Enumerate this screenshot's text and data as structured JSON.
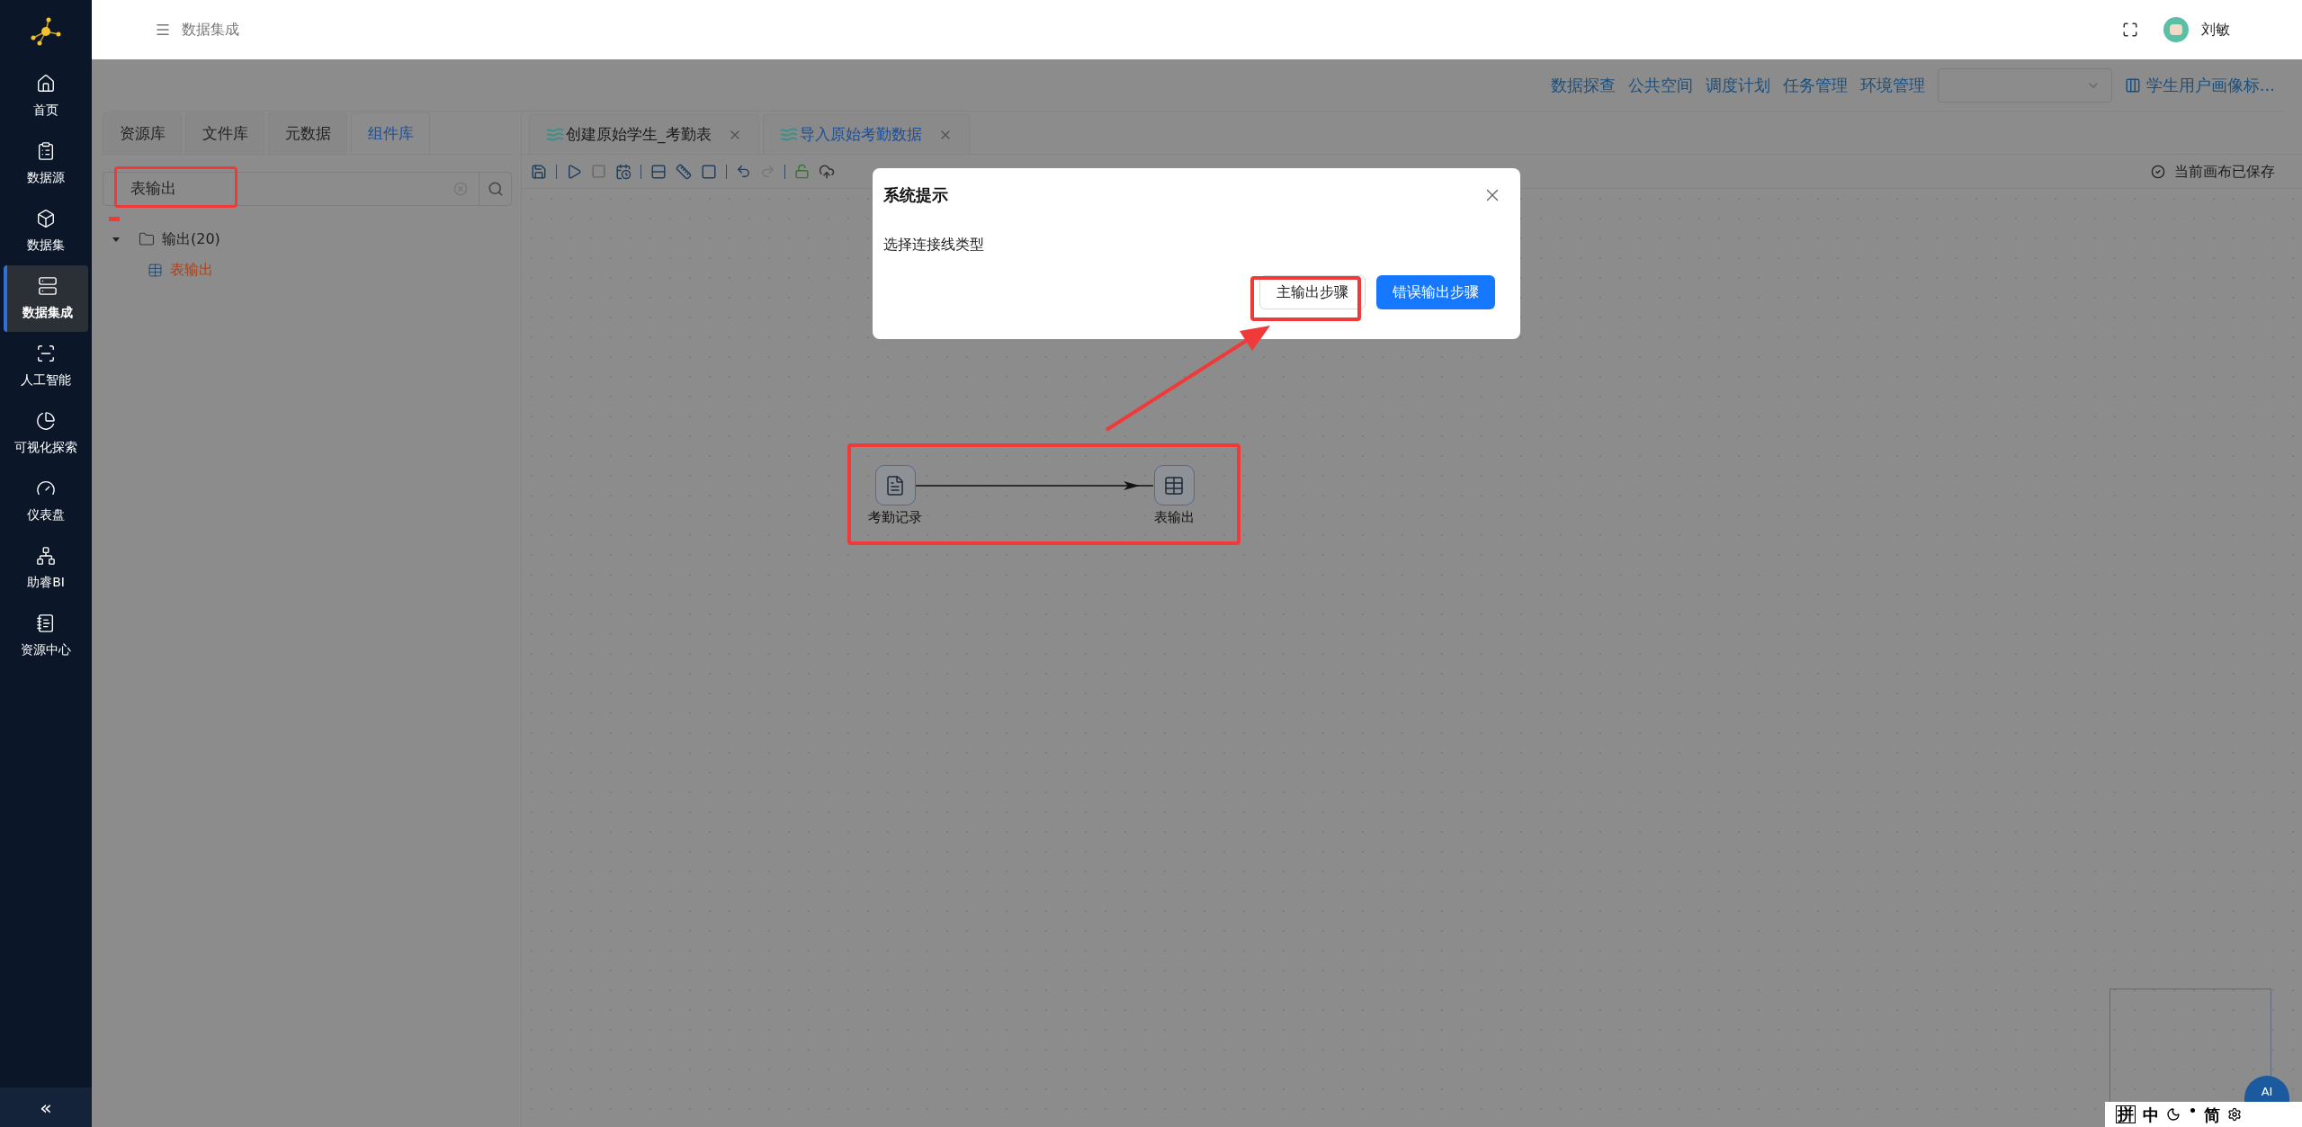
{
  "header": {
    "breadcrumb": "数据集成",
    "user": "刘敏"
  },
  "sidebar": {
    "items": [
      {
        "label": "首页",
        "selected": false
      },
      {
        "label": "数据源",
        "selected": false
      },
      {
        "label": "数据集",
        "selected": false
      },
      {
        "label": "数据集成",
        "selected": true
      },
      {
        "label": "人工智能",
        "selected": false
      },
      {
        "label": "可视化探索",
        "selected": false
      },
      {
        "label": "仪表盘",
        "selected": false
      },
      {
        "label": "助睿BI",
        "selected": false
      },
      {
        "label": "资源中心",
        "selected": false
      }
    ],
    "collapse": "«"
  },
  "top_nav": {
    "links": [
      "数据探查",
      "公共空间",
      "调度计划",
      "任务管理",
      "环境管理"
    ],
    "project": "学生用户画像标..."
  },
  "left_panel": {
    "tabs": [
      {
        "label": "资源库",
        "selected": false
      },
      {
        "label": "文件库",
        "selected": false
      },
      {
        "label": "元数据",
        "selected": false
      },
      {
        "label": "组件库",
        "selected": true
      }
    ],
    "search": {
      "value": "表输出"
    },
    "tree": [
      {
        "label": "输出(20)",
        "expanded": true,
        "children": [
          {
            "label": "表输出",
            "selected": true
          }
        ]
      }
    ]
  },
  "editor": {
    "tabs": [
      {
        "label": "创建原始学生_考勤表",
        "selected": false
      },
      {
        "label": "导入原始考勤数据",
        "selected": true
      }
    ],
    "status": "当前画布已保存"
  },
  "canvas": {
    "nodes": [
      {
        "label": "考勤记录",
        "kind": "file"
      },
      {
        "label": "表输出",
        "kind": "table"
      }
    ]
  },
  "dialog": {
    "title": "系统提示",
    "message": "选择连接线类型",
    "buttons": [
      {
        "label": "主输出步骤",
        "kind": "default"
      },
      {
        "label": "错误输出步骤",
        "kind": "primary"
      }
    ]
  },
  "ai_button": "AI",
  "ime_bar": [
    "拼",
    "中",
    "简"
  ]
}
